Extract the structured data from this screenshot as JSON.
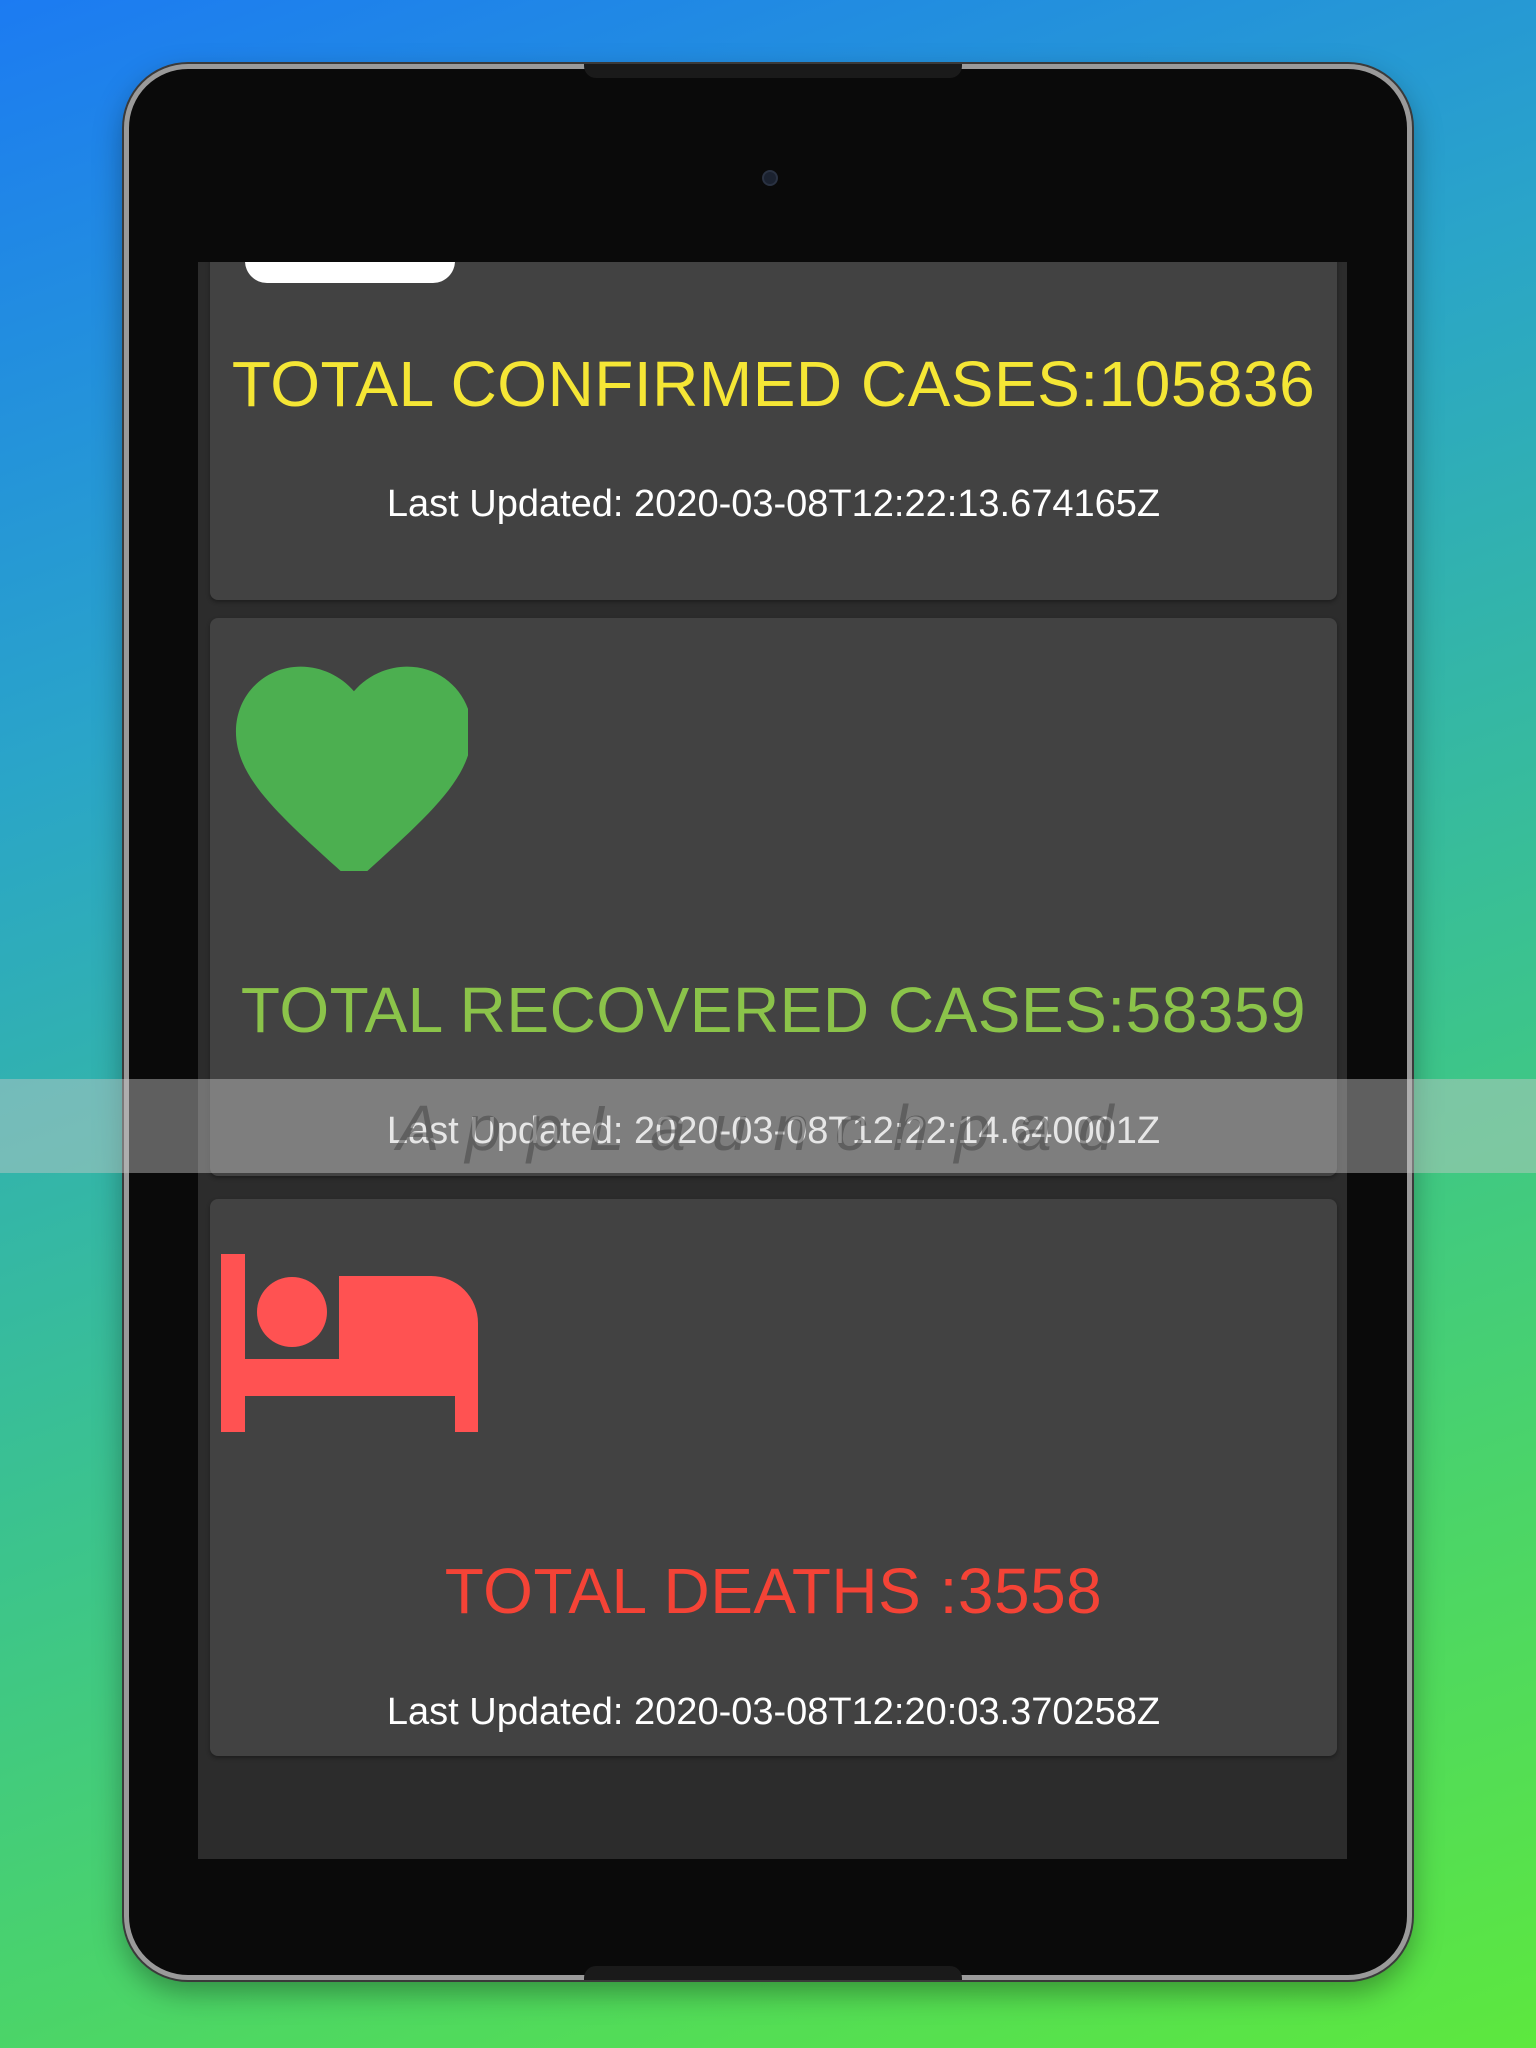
{
  "cards": {
    "confirmed": {
      "title": "TOTAL CONFIRMED CASES:105836",
      "updated": "Last Updated: 2020-03-08T12:22:13.674165Z",
      "color": "#f5e635"
    },
    "recovered": {
      "title": "TOTAL RECOVERED CASES:58359",
      "updated": "Last Updated: 2020-03-08T12:22:14.640001Z",
      "icon": "heart-icon",
      "color": "#8bc34a",
      "icon_color": "#4caf50"
    },
    "deaths": {
      "title": "TOTAL DEATHS :3558",
      "updated": "Last Updated: 2020-03-08T12:20:03.370258Z",
      "icon": "bed-icon",
      "color": "#f44336",
      "icon_color": "#ff5252"
    }
  },
  "watermark": {
    "text": "AppLaunchpad"
  }
}
